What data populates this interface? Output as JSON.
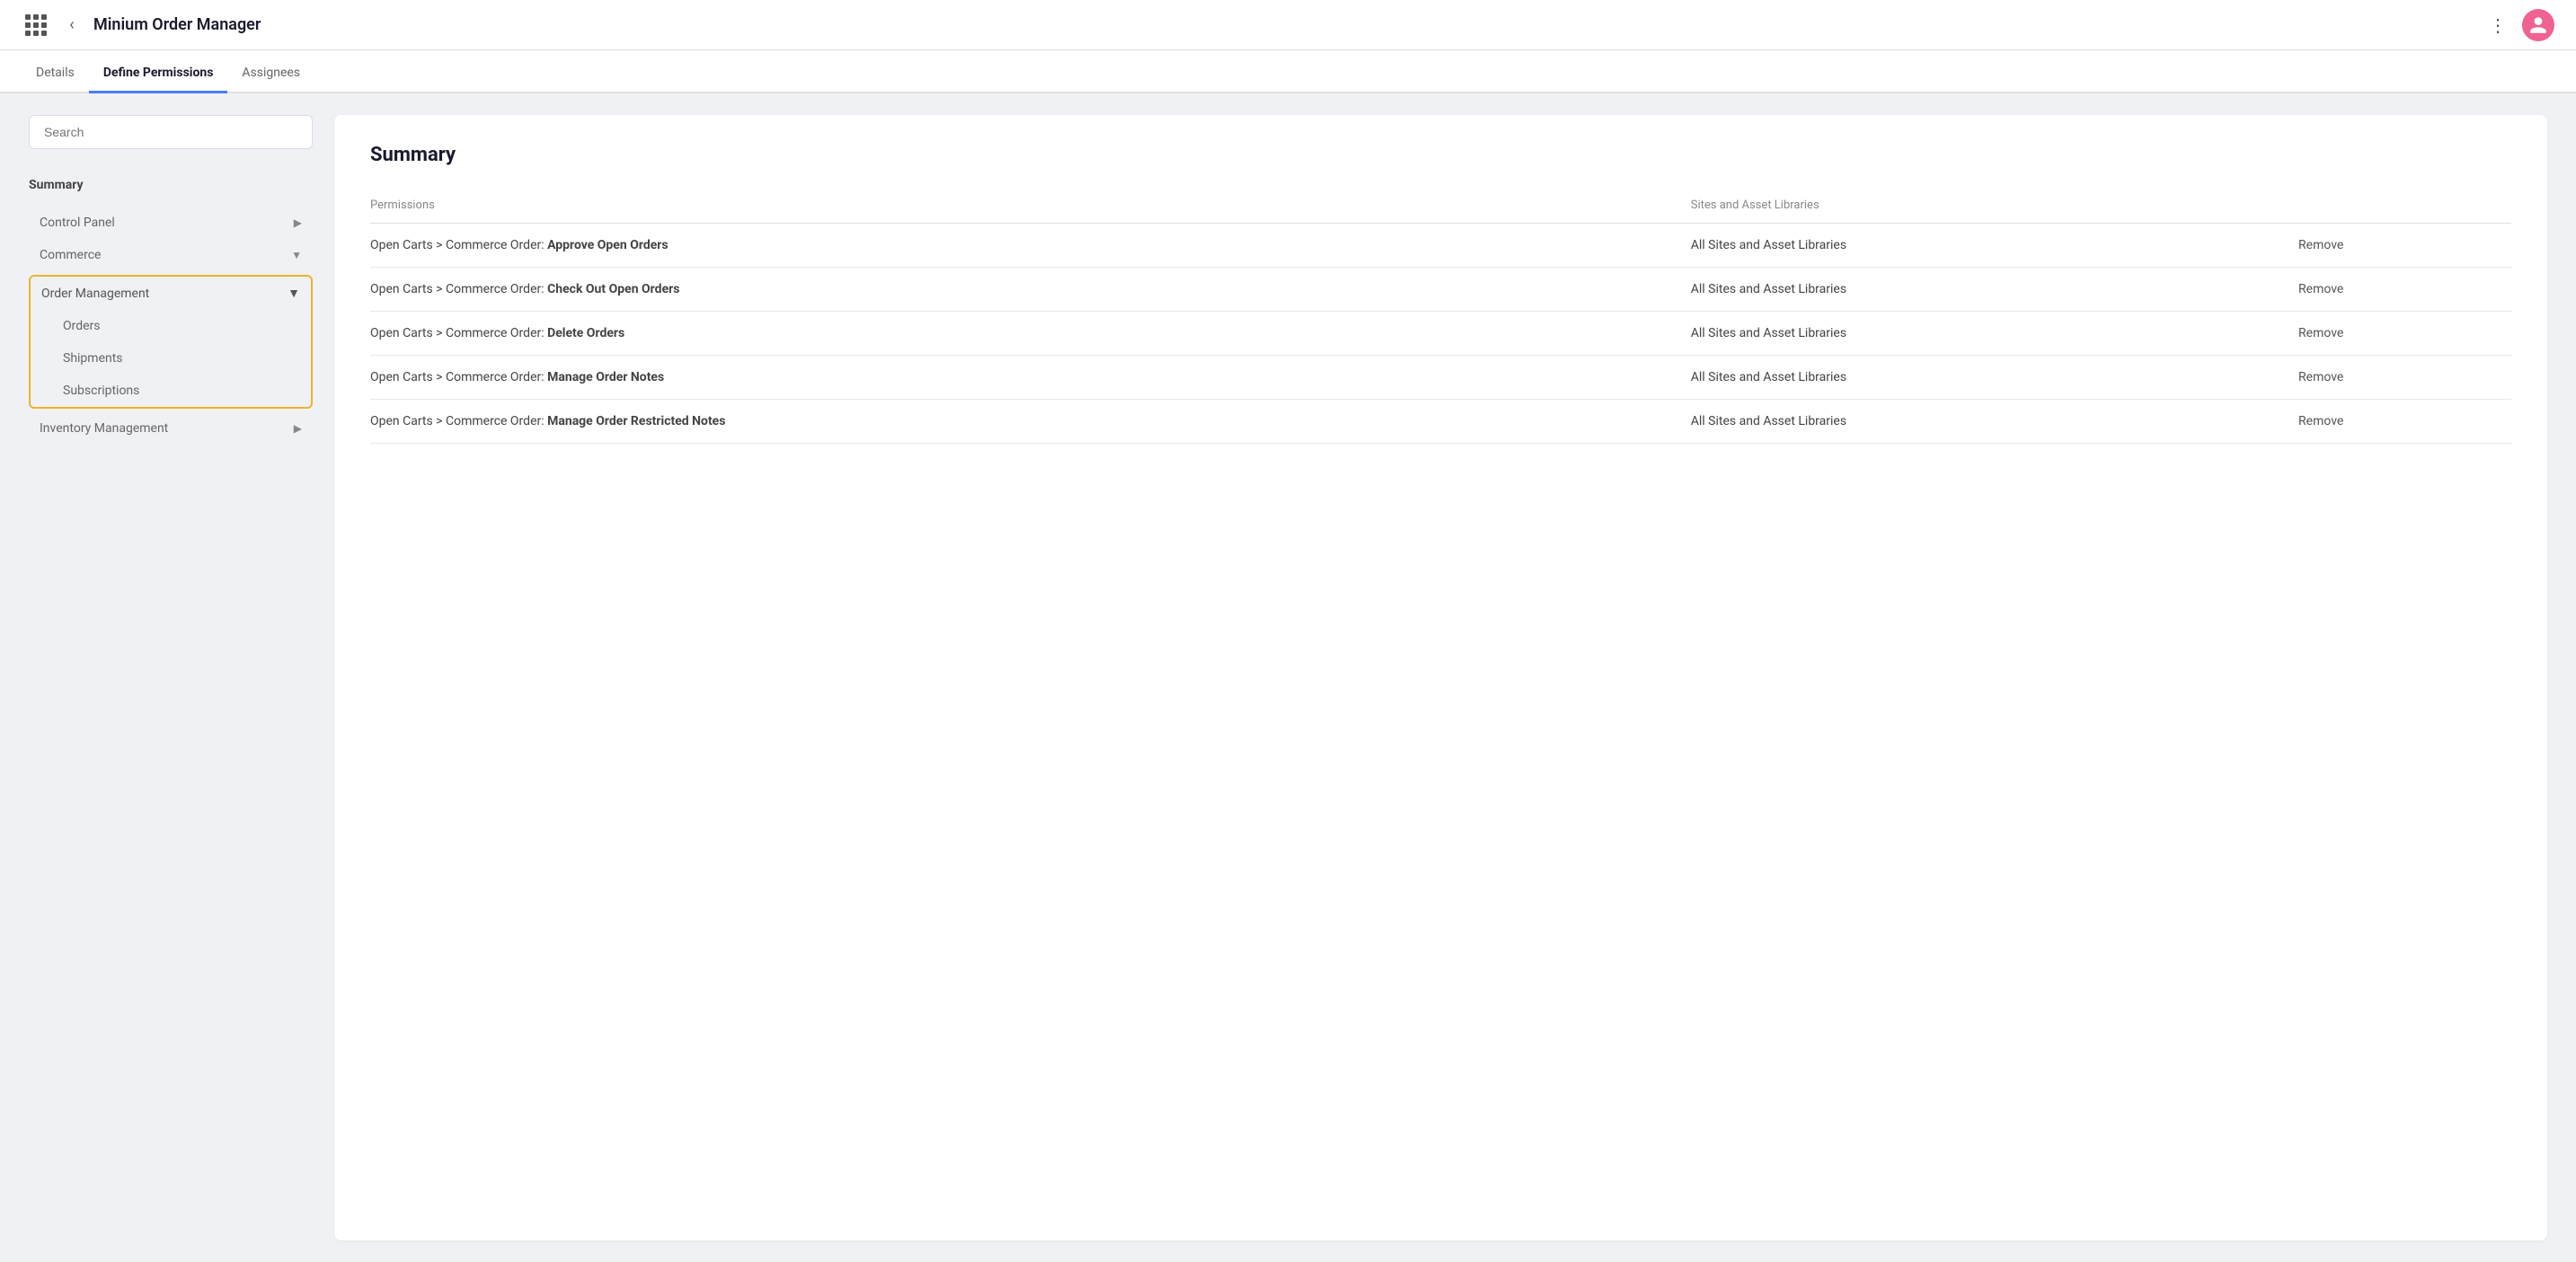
{
  "app": {
    "title": "Minium Order Manager"
  },
  "tabs": [
    {
      "id": "details",
      "label": "Details",
      "active": false
    },
    {
      "id": "define-permissions",
      "label": "Define Permissions",
      "active": true
    },
    {
      "id": "assignees",
      "label": "Assignees",
      "active": false
    }
  ],
  "sidebar": {
    "search_placeholder": "Search",
    "summary_label": "Summary",
    "items": [
      {
        "id": "control-panel",
        "label": "Control Panel",
        "has_chevron_right": true,
        "has_chevron_down": false
      },
      {
        "id": "commerce",
        "label": "Commerce",
        "has_chevron_right": false,
        "has_chevron_down": true
      },
      {
        "id": "order-management",
        "label": "Order Management",
        "has_chevron_down": true,
        "highlighted": true
      },
      {
        "id": "orders",
        "label": "Orders",
        "sub": true
      },
      {
        "id": "shipments",
        "label": "Shipments",
        "sub": true
      },
      {
        "id": "subscriptions",
        "label": "Subscriptions",
        "sub": true
      },
      {
        "id": "inventory-management",
        "label": "Inventory Management",
        "has_chevron_right": true
      }
    ]
  },
  "panel": {
    "title": "Summary",
    "table": {
      "col1_header": "Permissions",
      "col2_header": "Sites and Asset Libraries",
      "col3_header": "",
      "rows": [
        {
          "permission_prefix": "Open Carts > Commerce Order:",
          "permission_bold": "Approve Open Orders",
          "sites": "All Sites and Asset Libraries",
          "action": "Remove"
        },
        {
          "permission_prefix": "Open Carts > Commerce Order:",
          "permission_bold": "Check Out Open Orders",
          "sites": "All Sites and Asset Libraries",
          "action": "Remove"
        },
        {
          "permission_prefix": "Open Carts > Commerce Order:",
          "permission_bold": "Delete Orders",
          "sites": "All Sites and Asset Libraries",
          "action": "Remove"
        },
        {
          "permission_prefix": "Open Carts > Commerce Order:",
          "permission_bold": "Manage Order Notes",
          "sites": "All Sites and Asset Libraries",
          "action": "Remove"
        },
        {
          "permission_prefix": "Open Carts > Commerce Order:",
          "permission_bold": "Manage Order Restricted Notes",
          "sites": "All Sites and Asset Libraries",
          "action": "Remove"
        }
      ]
    }
  }
}
